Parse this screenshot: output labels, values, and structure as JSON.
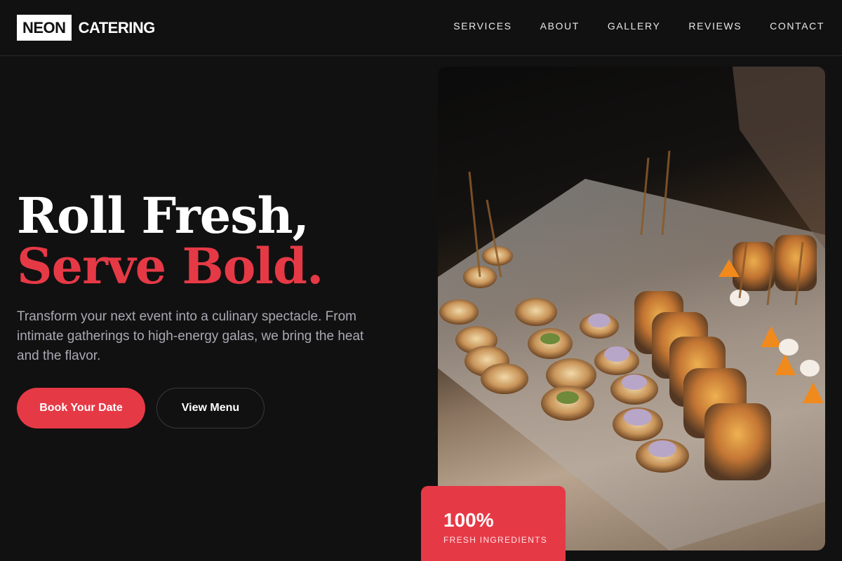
{
  "brand": {
    "logo_box": "NEON",
    "logo_text": "CATERING"
  },
  "nav": {
    "items": [
      "SERVICES",
      "ABOUT",
      "GALLERY",
      "REVIEWS",
      "CONTACT"
    ]
  },
  "hero": {
    "headline_line1": "Roll Fresh,",
    "headline_line2": "Serve Bold.",
    "subtext": "Transform your next event into a culinary spectacle. From intimate gatherings to high-energy galas, we bring the heat and the flavor.",
    "primary_button": "Book Your Date",
    "secondary_button": "View Menu"
  },
  "stat": {
    "value": "100%",
    "label": "FRESH INGREDIENTS"
  },
  "colors": {
    "accent": "#e63946",
    "background": "#111111",
    "text_muted": "#a9a9b3"
  }
}
